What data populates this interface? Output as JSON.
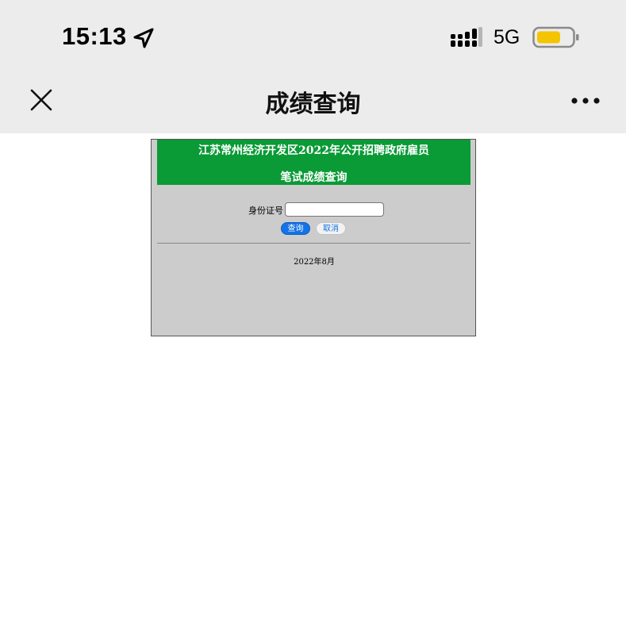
{
  "status_bar": {
    "time": "15:13",
    "network": "5G",
    "battery_color": "#f5c400",
    "icons": [
      "location-arrow-icon",
      "cellular-signal-icon",
      "battery-icon"
    ]
  },
  "nav_bar": {
    "title": "成绩查询",
    "close_icon": "close-icon",
    "more_icon": "more-icon"
  },
  "page": {
    "banner": {
      "line1": "江苏常州经济开发区2022年公开招聘政府雇员",
      "line2": "笔试成绩查询",
      "color": "#0a9a36"
    },
    "form": {
      "id_label": "身份证号",
      "id_value": "",
      "query_label": "查询",
      "cancel_label": "取消"
    },
    "footer_date": "2022年8月"
  }
}
